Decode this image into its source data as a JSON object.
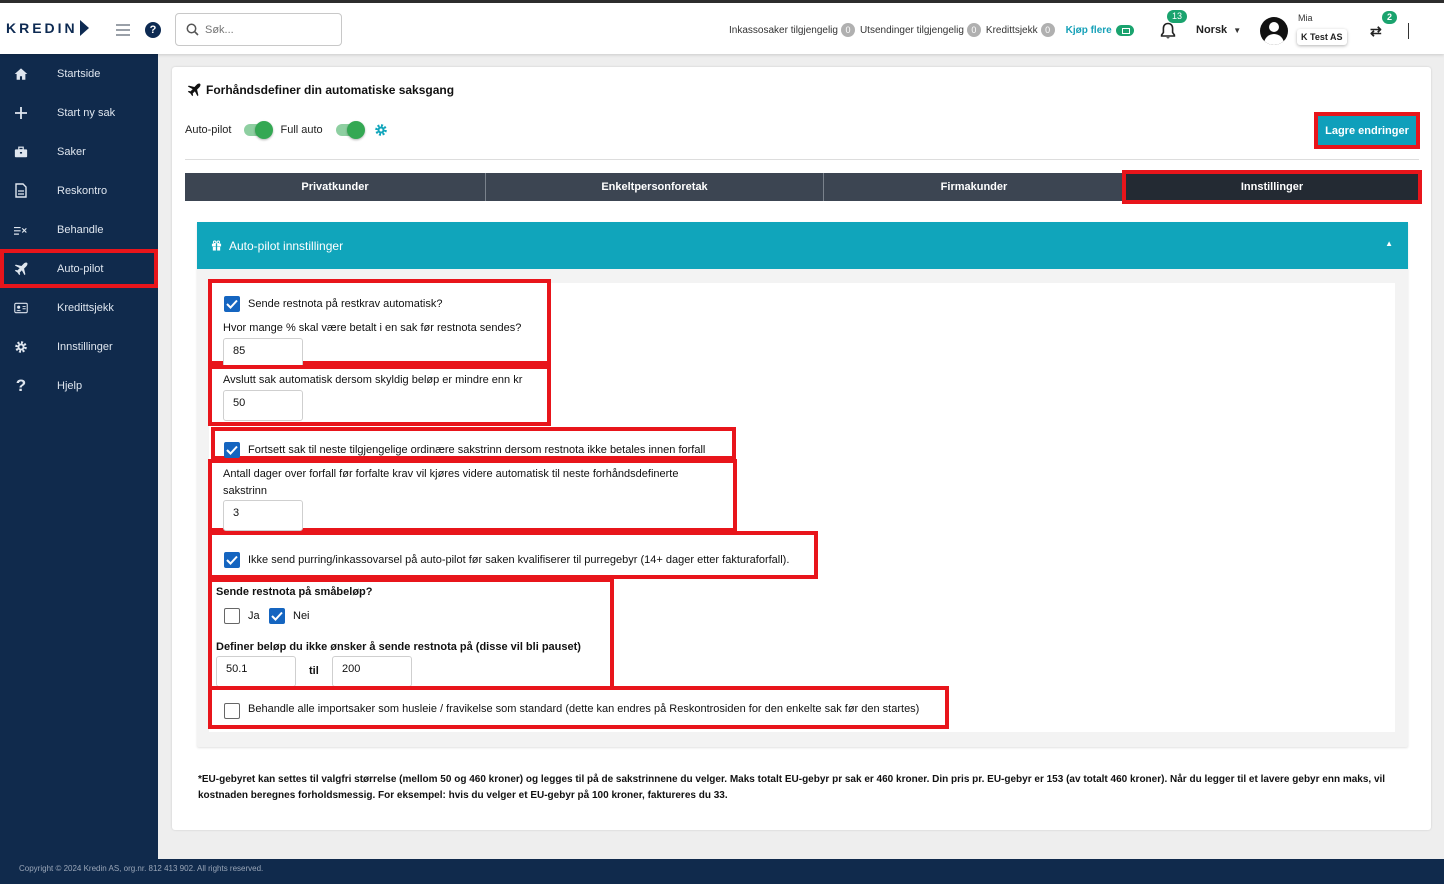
{
  "topbar": {
    "logo_text": "KREDIN",
    "search_placeholder": "Søk...",
    "status": [
      {
        "label": "Inkassosaker tilgjengelig",
        "count": "0"
      },
      {
        "label": "Utsendinger tilgjengelig",
        "count": "0"
      },
      {
        "label": "Kredittsjekk",
        "count": "0"
      }
    ],
    "buy_more": "Kjøp flere",
    "notifications_count": "13",
    "language": "Norsk",
    "user_name": "Mia",
    "company": "K Test AS",
    "switch_count": "2"
  },
  "sidebar": {
    "items": [
      {
        "label": "Startside",
        "icon": "home-icon"
      },
      {
        "label": "Start ny sak",
        "icon": "plus-icon"
      },
      {
        "label": "Saker",
        "icon": "briefcase-icon"
      },
      {
        "label": "Reskontro",
        "icon": "document-icon"
      },
      {
        "label": "Behandle",
        "icon": "list-check-icon"
      },
      {
        "label": "Auto-pilot",
        "icon": "airplane-icon",
        "highlighted": true
      },
      {
        "label": "Kredittsjekk",
        "icon": "id-card-icon"
      },
      {
        "label": "Innstillinger",
        "icon": "gear-icon"
      },
      {
        "label": "Hjelp",
        "icon": "question-icon"
      }
    ]
  },
  "page": {
    "title": "Forhåndsdefiner din automatiske saksgang",
    "autopilot_label": "Auto-pilot",
    "fullauto_label": "Full auto",
    "autopilot_on": true,
    "fullauto_on": true,
    "save_button": "Lagre endringer",
    "tabs": [
      {
        "label": "Privatkunder",
        "active": false
      },
      {
        "label": "Enkeltpersonforetak",
        "active": false
      },
      {
        "label": "Firmakunder",
        "active": false
      },
      {
        "label": "Innstillinger",
        "active": true
      }
    ]
  },
  "settings": {
    "header": "Auto-pilot innstillinger",
    "send_restnota_label": "Sende restnota på restkrav automatisk?",
    "send_restnota_checked": true,
    "percent_question": "Hvor mange % skal være betalt i en sak før restnota sendes?",
    "percent_value": "85",
    "close_case_label": "Avslutt sak automatisk dersom skyldig beløp er mindre enn kr",
    "close_case_value": "50",
    "continue_label": "Fortsett sak til neste tilgjengelige ordinære sakstrinn dersom restnota ikke betales innen forfall",
    "continue_checked": true,
    "days_label_line1": "Antall dager over forfall før forfalte krav vil kjøres videre automatisk til neste forhåndsdefinerte",
    "days_label_line2": "sakstrinn",
    "days_value": "3",
    "no_reminder_label": "Ikke send purring/inkassovarsel på auto-pilot før saken kvalifiserer til purregebyr (14+ dager etter fakturaforfall).",
    "no_reminder_checked": true,
    "small_amount_question": "Sende restnota på småbeløp?",
    "yes_label": "Ja",
    "yes_checked": false,
    "no_label": "Nei",
    "no_checked": true,
    "range_label": "Definer beløp du ikke ønsker å sende restnota på (disse vil bli pauset)",
    "range_from": "50.1",
    "range_to_label": "til",
    "range_to": "200",
    "rent_label": "Behandle alle importsaker som husleie / fravikelse som standard (dette kan endres på Reskontrosiden for den enkelte sak før den startes)",
    "rent_checked": false
  },
  "footnote": "*EU-gebyret kan settes til valgfri størrelse (mellom 50 og 460 kroner) og legges til på de sakstrinnene du velger. Maks totalt EU-gebyr pr sak er 460 kroner. Din pris pr. EU-gebyr er 153 (av totalt 460 kroner). Når du legger til et lavere gebyr enn maks, vil kostnaden beregnes forholdsmessig. For eksempel: hvis du velger et EU-gebyr på 100 kroner, faktureres du 33.",
  "footer": "Copyright © 2024 Kredin AS, org.nr. 812 413 902. All rights reserved.",
  "colors": {
    "sidebar": "#102a4c",
    "accent": "#10a5bb",
    "highlight": "#e8151b",
    "toggle": "#34a853",
    "checkbox": "#1565c0"
  }
}
